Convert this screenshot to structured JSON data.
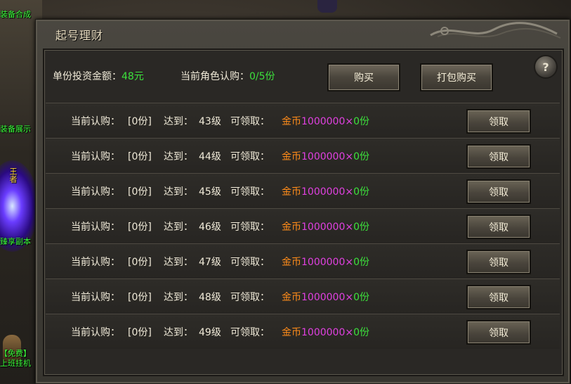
{
  "window": {
    "title": "起号理财"
  },
  "side": {
    "labels": [
      "装备合成",
      "装备展示",
      "王者",
      "臻享副本",
      "【免费】",
      "上班挂机"
    ]
  },
  "summary": {
    "unit_price_label": "单份投资金额：",
    "unit_price_value": "48元",
    "subscribed_label": "当前角色认购：",
    "subscribed_value": "0/5份",
    "buy_label": "购买",
    "bundle_label": "打包购买",
    "help_label": "?"
  },
  "rows": [
    {
      "current_label": "当前认购：",
      "current_value": "[0份]",
      "reach_label": "达到：",
      "level": "43级",
      "claimable_label": "可领取：",
      "reward_currency": "金币",
      "reward_amount": "1000000×",
      "reward_count": "0份",
      "claim_label": "领取"
    },
    {
      "current_label": "当前认购：",
      "current_value": "[0份]",
      "reach_label": "达到：",
      "level": "44级",
      "claimable_label": "可领取：",
      "reward_currency": "金币",
      "reward_amount": "1000000×",
      "reward_count": "0份",
      "claim_label": "领取"
    },
    {
      "current_label": "当前认购：",
      "current_value": "[0份]",
      "reach_label": "达到：",
      "level": "45级",
      "claimable_label": "可领取：",
      "reward_currency": "金币",
      "reward_amount": "1000000×",
      "reward_count": "0份",
      "claim_label": "领取"
    },
    {
      "current_label": "当前认购：",
      "current_value": "[0份]",
      "reach_label": "达到：",
      "level": "46级",
      "claimable_label": "可领取：",
      "reward_currency": "金币",
      "reward_amount": "1000000×",
      "reward_count": "0份",
      "claim_label": "领取"
    },
    {
      "current_label": "当前认购：",
      "current_value": "[0份]",
      "reach_label": "达到：",
      "level": "47级",
      "claimable_label": "可领取：",
      "reward_currency": "金币",
      "reward_amount": "1000000×",
      "reward_count": "0份",
      "claim_label": "领取"
    },
    {
      "current_label": "当前认购：",
      "current_value": "[0份]",
      "reach_label": "达到：",
      "level": "48级",
      "claimable_label": "可领取：",
      "reward_currency": "金币",
      "reward_amount": "1000000×",
      "reward_count": "0份",
      "claim_label": "领取"
    },
    {
      "current_label": "当前认购：",
      "current_value": "[0份]",
      "reach_label": "达到：",
      "level": "49级",
      "claimable_label": "可领取：",
      "reward_currency": "金币",
      "reward_amount": "1000000×",
      "reward_count": "0份",
      "claim_label": "领取"
    }
  ],
  "colors": {
    "green": "#3ce13c",
    "orange": "#ff8c1a",
    "magenta": "#e040e0"
  }
}
